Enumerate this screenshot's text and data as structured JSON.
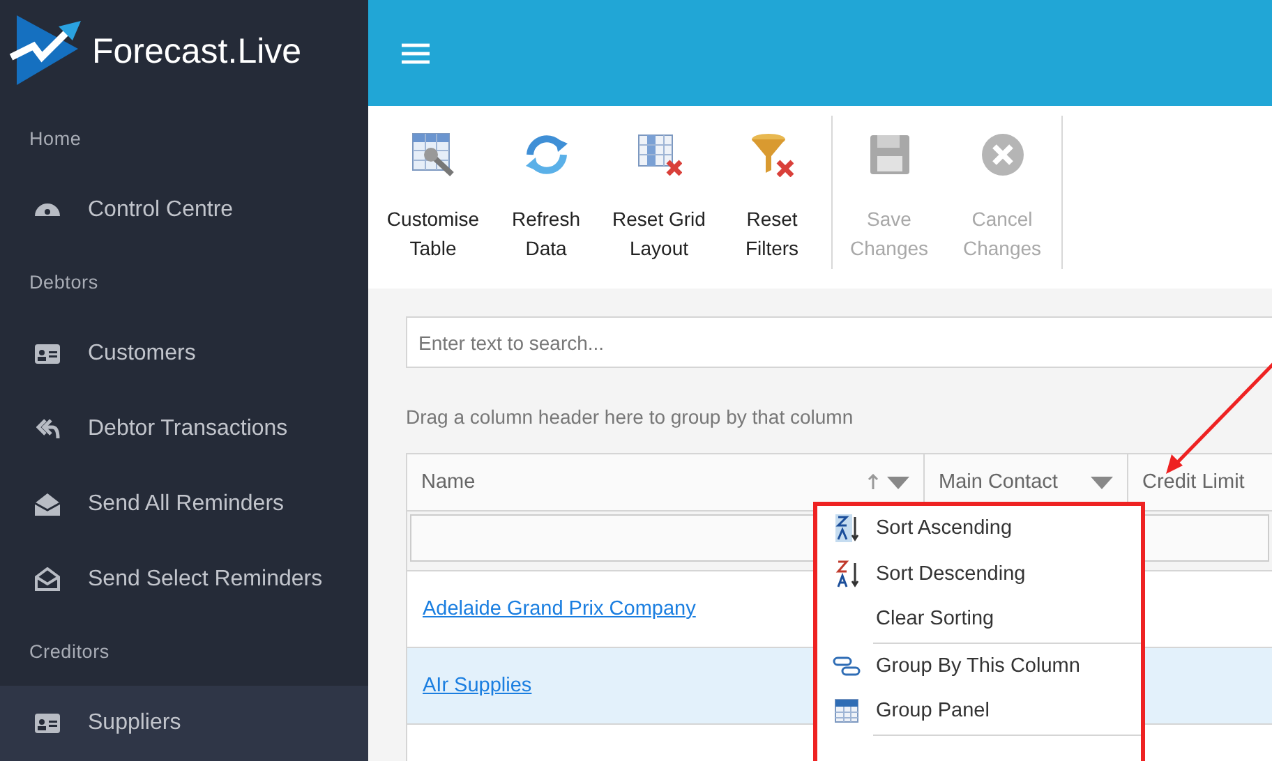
{
  "logo": {
    "text": "Forecast.Live"
  },
  "sidebar": {
    "sections": [
      {
        "title": "Home",
        "items": [
          {
            "label": "Control Centre",
            "selected": false
          }
        ]
      },
      {
        "title": "Debtors",
        "items": [
          {
            "label": "Customers",
            "selected": false
          },
          {
            "label": "Debtor Transactions",
            "selected": false
          },
          {
            "label": "Send All Reminders",
            "selected": false
          },
          {
            "label": "Send Select Reminders",
            "selected": false
          }
        ]
      },
      {
        "title": "Creditors",
        "items": [
          {
            "label": "Suppliers",
            "selected": true
          }
        ]
      }
    ]
  },
  "toolbar": {
    "groups": [
      [
        {
          "label": "Customise Table",
          "disabled": false
        },
        {
          "label": "Refresh Data",
          "disabled": false
        },
        {
          "label": "Reset Grid Layout",
          "disabled": false
        },
        {
          "label": "Reset Filters",
          "disabled": false
        }
      ],
      [
        {
          "label": "Save Changes",
          "disabled": true
        },
        {
          "label": "Cancel Changes",
          "disabled": true
        }
      ]
    ]
  },
  "search": {
    "placeholder": "Enter text to search..."
  },
  "group_hint": "Drag a column header here to group by that column",
  "table": {
    "columns": [
      {
        "label": "Name"
      },
      {
        "label": "Main Contact"
      },
      {
        "label": "Credit Limit"
      }
    ],
    "rows": [
      {
        "name": "Adelaide Grand Prix Company",
        "selected": false
      },
      {
        "name": "AIr Supplies",
        "selected": true
      }
    ]
  },
  "context_menu": {
    "groups": [
      [
        {
          "label": "Sort Ascending"
        },
        {
          "label": "Sort Descending"
        },
        {
          "label": "Clear Sorting"
        }
      ],
      [
        {
          "label": "Group By This Column"
        },
        {
          "label": "Group Panel"
        }
      ]
    ]
  }
}
